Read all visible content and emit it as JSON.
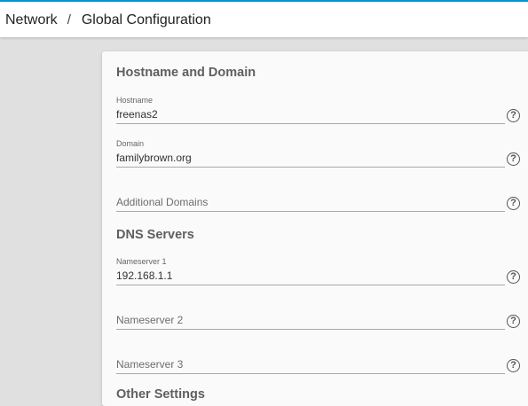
{
  "header": {
    "breadcrumb": [
      "Network",
      "Global Configuration"
    ],
    "separator": "/",
    "accent_color": "#0095d5"
  },
  "form": {
    "hostname_section": {
      "title": "Hostname and Domain",
      "hostname": {
        "label": "Hostname",
        "value": "freenas2"
      },
      "domain": {
        "label": "Domain",
        "value": "familybrown.org"
      },
      "additional_domains": {
        "placeholder": "Additional Domains",
        "value": ""
      }
    },
    "dns_section": {
      "title": "DNS Servers",
      "nameserver1": {
        "label": "Nameserver 1",
        "value": "192.168.1.1"
      },
      "nameserver2": {
        "placeholder": "Nameserver 2",
        "value": ""
      },
      "nameserver3": {
        "placeholder": "Nameserver 3",
        "value": ""
      }
    },
    "other_section": {
      "title": "Other Settings"
    },
    "help_glyph": "?",
    "help_icon": "help-circle-icon"
  }
}
